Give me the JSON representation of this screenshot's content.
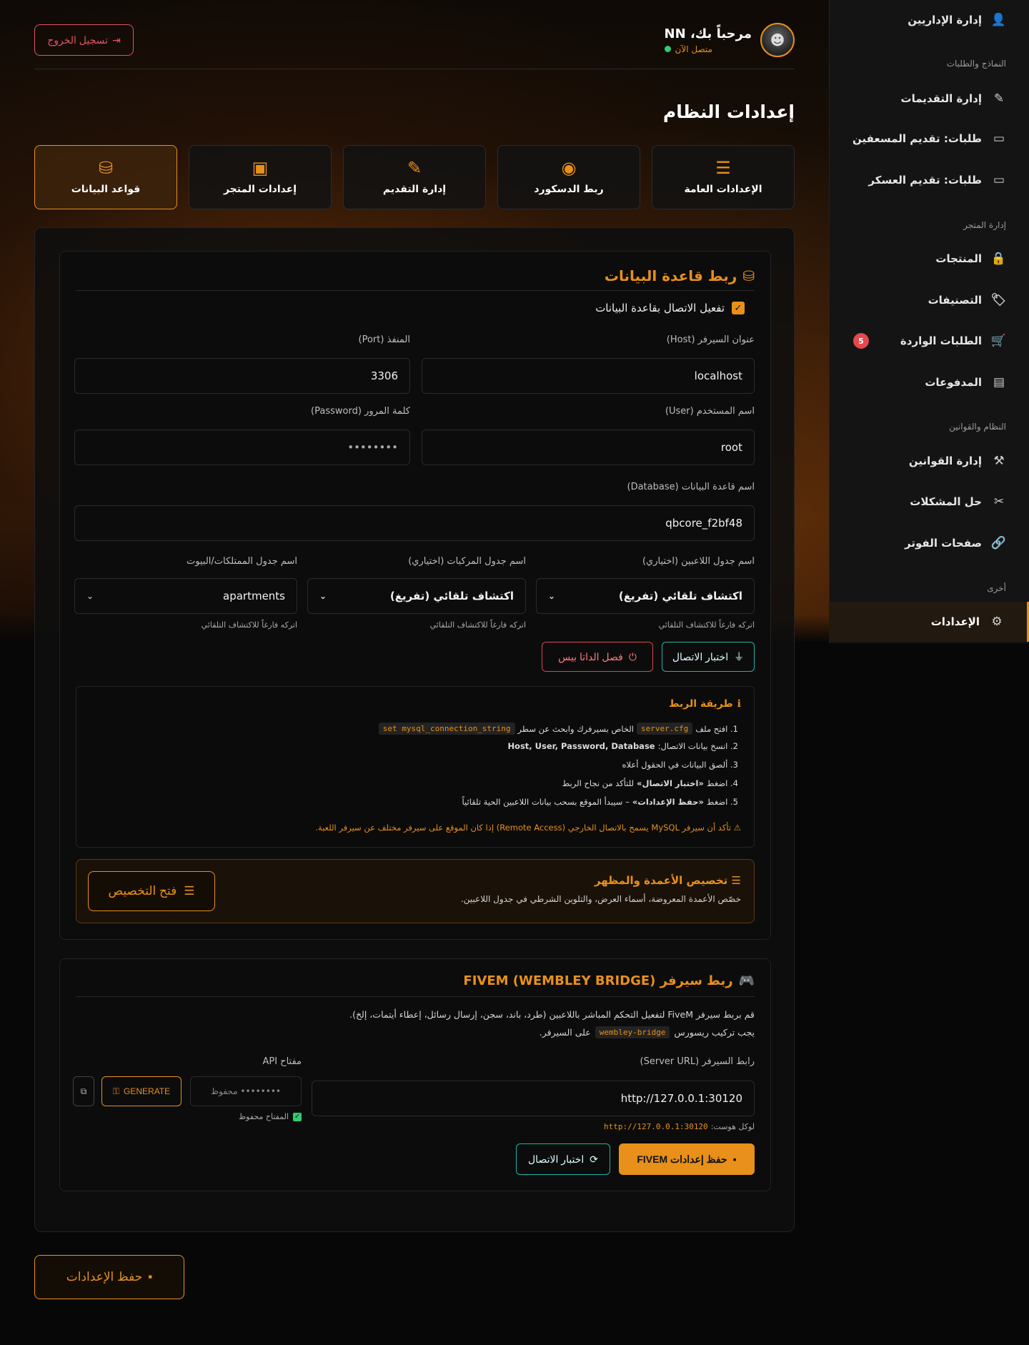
{
  "sidebar": {
    "top_item": {
      "label": "إدارة الإداريين",
      "icon": "user-icon"
    },
    "sections": [
      {
        "heading": "النماذج والطلبات"
      },
      {
        "heading": "إدارة المتجر"
      },
      {
        "heading": "النظام والقوانين"
      },
      {
        "heading": "أخرى"
      }
    ],
    "items": [
      {
        "label": "إدارة التقديمات",
        "icon": "edit-document-icon"
      },
      {
        "label": "طلبات: تقديم المسعفين",
        "icon": "inbox-icon"
      },
      {
        "label": "طلبات: تقديم العسكر",
        "icon": "inbox-icon"
      },
      {
        "label": "المنتجات",
        "icon": "bag-icon"
      },
      {
        "label": "التصنيفات",
        "icon": "tag-icon"
      },
      {
        "label": "الطلبات الواردة",
        "icon": "cart-icon",
        "badge": "5"
      },
      {
        "label": "المدفوعات",
        "icon": "money-icon"
      },
      {
        "label": "إدارة القوانين",
        "icon": "gavel-icon"
      },
      {
        "label": "حل المشكلات",
        "icon": "tools-icon"
      },
      {
        "label": "صفحات الفوتر",
        "icon": "link-icon"
      },
      {
        "label": "الإعدادات",
        "icon": "gear-icon",
        "active": true
      }
    ]
  },
  "header": {
    "logout_label": "تسجيل الخروج",
    "user_name": "مرحباً بك، NN",
    "user_status": "متصل الآن"
  },
  "page_title": "إعدادات النظام",
  "tabs": [
    {
      "label": "الإعدادات العامة",
      "icon": "sliders-icon"
    },
    {
      "label": "ربط الدسكورد",
      "icon": "discord-icon"
    },
    {
      "label": "إدارة التقديم",
      "icon": "edit-document-icon"
    },
    {
      "label": "إعدادات المتجر",
      "icon": "bag-icon"
    },
    {
      "label": "قواعد البيانات",
      "icon": "database-icon",
      "active": true
    }
  ],
  "db": {
    "title": "ربط قاعدة البيانات",
    "enable_label": "تفعيل الاتصال بقاعدة البيانات",
    "enabled": true,
    "host_label": "عنوان السيرفر (Host)",
    "host_value": "localhost",
    "port_label": "المنفذ (Port)",
    "port_value": "3306",
    "user_label": "اسم المستخدم (User)",
    "user_value": "root",
    "password_label": "كلمة المرور (Password)",
    "password_value": "••••••••",
    "database_label": "اسم قاعدة البيانات (Database)",
    "database_value": "qbcore_f2bf48",
    "players_table_label": "اسم جدول اللاعبين (اختياري)",
    "players_table_value": "اكتشاف تلقائي (تفريغ)",
    "players_table_hint": "اتركه فارغاً للاكتشاف التلقائي",
    "vehicles_table_label": "اسم جدول المركبات (اختياري)",
    "vehicles_table_value": "اكتشاف تلقائي (تفريغ)",
    "vehicles_table_hint": "اتركه فارغاً للاكتشاف التلقائي",
    "properties_table_label": "اسم جدول الممتلكات/البيوت",
    "properties_table_value": "apartments",
    "properties_table_hint": "اتركه فارغاً للاكتشاف التلقائي",
    "test_label": "اختبار الاتصال",
    "disconnect_label": "فصل الداتا بيس"
  },
  "guide": {
    "title": "طريقة الربط",
    "step1_a": "1. افتح ملف",
    "step1_code1": "server.cfg",
    "step1_b": "الخاص بسيرفرك وابحث عن سطر",
    "step1_code2": "set mysql_connection_string",
    "step2": "2. انسخ بيانات الاتصال:",
    "step2_bold": "Host, User, Password, Database",
    "step3": "3. ألصق البيانات في الحقول أعلاه",
    "step4_a": "4. اضغط",
    "step4_bold": "«اختبار الاتصال»",
    "step4_b": "للتأكد من نجاح الربط",
    "step5_a": "5. اضغط",
    "step5_bold": "«حفظ الإعدادات»",
    "step5_b": "– سيبدأ الموقع بسحب بيانات اللاعبين الحية تلقائياً",
    "warning": "تأكد أن سيرفر MySQL يسمح بالاتصال الخارجي (Remote Access) إذا كان الموقع على سيرفر مختلف عن سيرفر اللعبة."
  },
  "customize": {
    "title": "تخصيص الأعمدة والمظهر",
    "desc": "خصّص الأعمدة المعروضة، أسماء العرض، والتلوين الشرطي في جدول اللاعبين.",
    "button": "فتح التخصيص"
  },
  "fivem": {
    "title": "ربط سيرفر FIVEM (WEMBLEY BRIDGE)",
    "desc1": "قم بربط سيرفر FiveM لتفعيل التحكم المباشر باللاعبين (طرد، باند، سجن، إرسال رسائل، إعطاء أيتمات، إلخ).",
    "desc2_a": "يجب تركيب ريسورس",
    "desc2_code": "wembley-bridge",
    "desc2_b": "على السيرفر.",
    "url_label": "رابط السيرفر (Server URL)",
    "url_value": "http://127.0.0.1:30120",
    "url_hint_label": "لوكل هوست:",
    "url_hint_value": "http://127.0.0.1:30120",
    "api_label": "مفتاح API",
    "api_placeholder": "••••••••  محفوظ",
    "generate_label": "GENERATE",
    "key_saved": "المفتاح محفوظ",
    "save_label": "حفظ إعدادات FIVEM",
    "test_label": "اختبار الاتصال"
  },
  "save_all_label": "حفظ الإعدادات",
  "colors": {
    "accent": "#e8901a",
    "teal": "#1fb5a8",
    "danger": "#e05563",
    "online": "#2ecc71"
  }
}
